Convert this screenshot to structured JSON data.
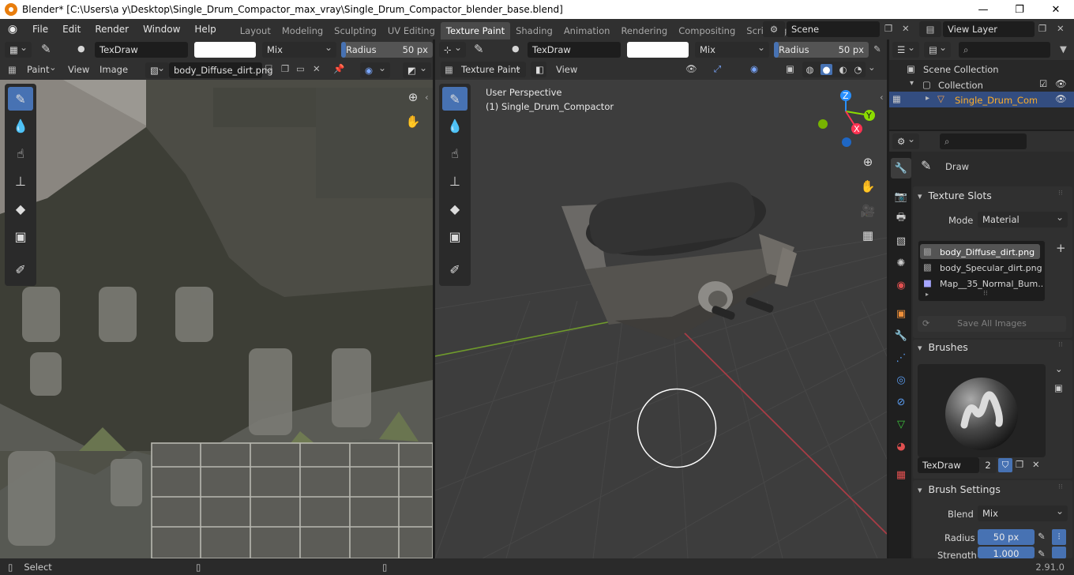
{
  "window": {
    "title": "Blender* [C:\\Users\\a y\\Desktop\\Single_Drum_Compactor_max_vray\\Single_Drum_Compactor_blender_base.blend]",
    "min": "—",
    "max": "❐",
    "close": "✕"
  },
  "menu": [
    "File",
    "Edit",
    "Render",
    "Window",
    "Help"
  ],
  "workspaces": [
    {
      "label": "Layout",
      "active": false
    },
    {
      "label": "Modeling",
      "active": false
    },
    {
      "label": "Sculpting",
      "active": false
    },
    {
      "label": "UV Editing",
      "active": false
    },
    {
      "label": "Texture Paint",
      "active": true
    },
    {
      "label": "Shading",
      "active": false
    },
    {
      "label": "Animation",
      "active": false
    },
    {
      "label": "Rendering",
      "active": false
    },
    {
      "label": "Compositing",
      "active": false
    },
    {
      "label": "Scripting",
      "active": false
    }
  ],
  "add_workspace": "+",
  "scene": {
    "value": "Scene"
  },
  "view_layer": {
    "value": "View Layer"
  },
  "image_editor": {
    "brush_name": "TexDraw",
    "blend": "Mix",
    "radius_label": "Radius",
    "radius_value": "50 px",
    "mode": "Paint",
    "menu_view": "View",
    "menu_image": "Image",
    "image_name": "body_Diffuse_dirt.png"
  },
  "viewport": {
    "brush_name": "TexDraw",
    "blend": "Mix",
    "radius_label": "Radius",
    "radius_value": "50 px",
    "mode": "Texture Paint",
    "menu_view": "View",
    "overlay_line1": "User Perspective",
    "overlay_line2": "(1) Single_Drum_Compactor",
    "gizmo_x": "X",
    "gizmo_y": "Y",
    "gizmo_z": "Z"
  },
  "outliner": {
    "scene_collection": "Scene Collection",
    "collection": "Collection",
    "object": "Single_Drum_Compa"
  },
  "properties": {
    "tool_name": "Draw",
    "texture_slots": {
      "header": "Texture Slots",
      "mode_label": "Mode",
      "mode_value": "Material",
      "items": [
        "body_Diffuse_dirt.png",
        "body_Specular_dirt.png",
        "Map__35_Normal_Bum..."
      ],
      "add": "+",
      "save_all": "Save All Images"
    },
    "brushes": {
      "header": "Brushes",
      "brush_name": "TexDraw",
      "users": "2"
    },
    "brush_settings": {
      "header": "Brush Settings",
      "blend_label": "Blend",
      "blend_value": "Mix",
      "radius_label": "Radius",
      "radius_value": "50 px",
      "strength_label": "Strength",
      "strength_value": "1.000"
    }
  },
  "status": {
    "select": "Select",
    "version": "2.91.0"
  },
  "colors": {
    "accent": "#4772b3",
    "header": "#303030",
    "viewport_bg": "#3d3d3d",
    "x_axis": "#ff3352",
    "y_axis": "#8bdc00",
    "z_axis": "#2890ff"
  }
}
